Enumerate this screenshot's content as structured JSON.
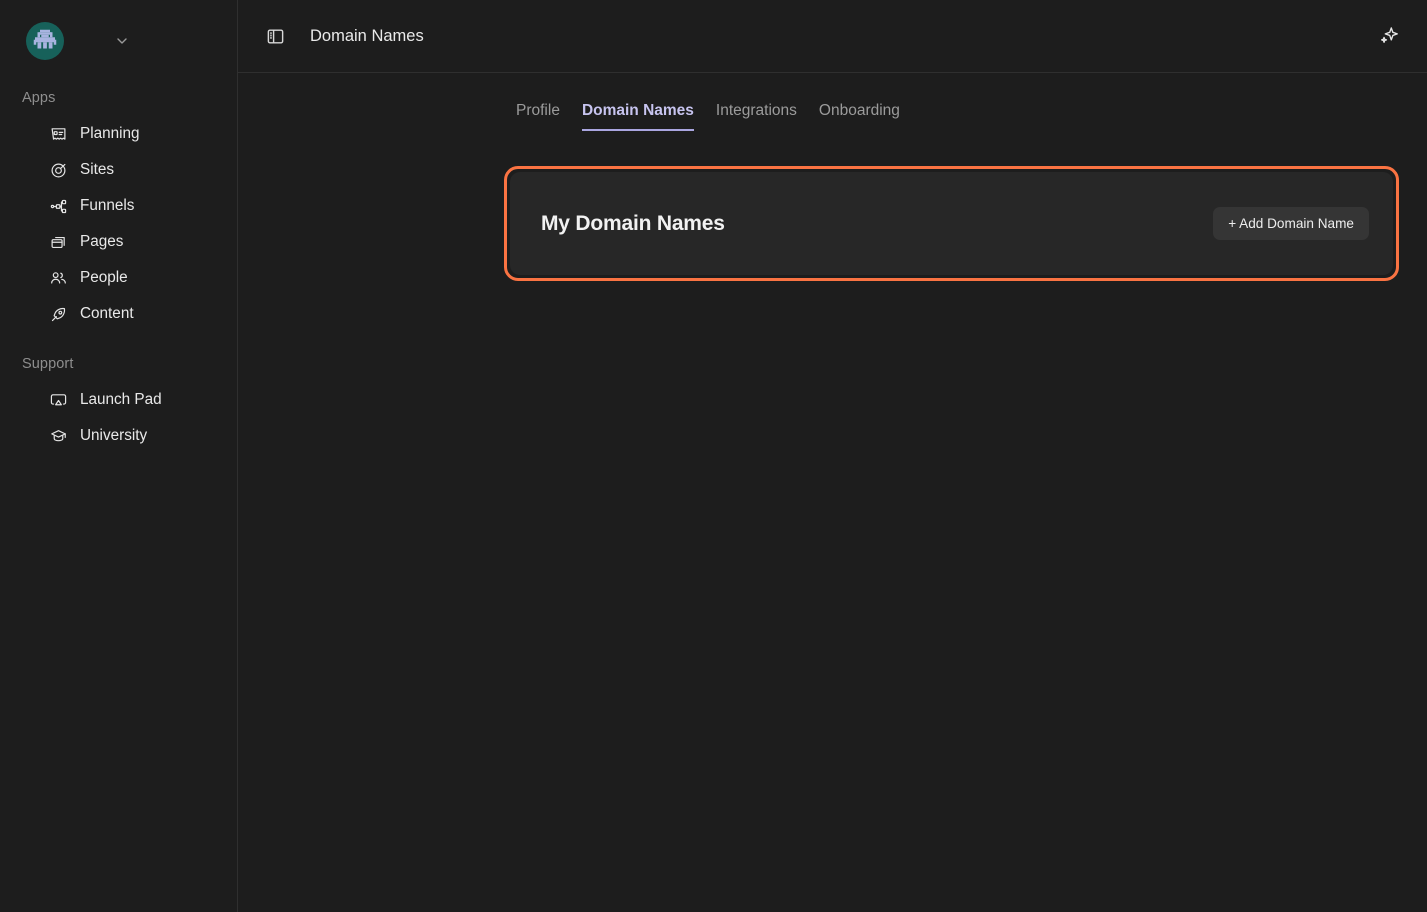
{
  "sidebar": {
    "brand": {
      "logo_icon": "space-invader-avatar",
      "logo_bg_color": "#17615a",
      "logo_fg_color": "#a8b4e0",
      "chevron_icon": "chevron-down-icon"
    },
    "sections": [
      {
        "label": "Apps",
        "items": [
          {
            "label": "Planning",
            "icon": "receipt-id-icon"
          },
          {
            "label": "Sites",
            "icon": "globe-target-icon"
          },
          {
            "label": "Funnels",
            "icon": "workflow-branch-icon"
          },
          {
            "label": "Pages",
            "icon": "stacked-windows-icon"
          },
          {
            "label": "People",
            "icon": "users-icon"
          },
          {
            "label": "Content",
            "icon": "pen-nib-icon"
          }
        ]
      },
      {
        "label": "Support",
        "items": [
          {
            "label": "Launch Pad",
            "icon": "airplay-icon"
          },
          {
            "label": "University",
            "icon": "graduation-cap-icon"
          }
        ]
      }
    ]
  },
  "topbar": {
    "panel_toggle_icon": "sidebar-panel-icon",
    "title": "Domain Names",
    "sparkle_icon": "sparkles-ai-icon"
  },
  "tabs": [
    {
      "label": "Profile",
      "active": false
    },
    {
      "label": "Domain Names",
      "active": true
    },
    {
      "label": "Integrations",
      "active": false
    },
    {
      "label": "Onboarding",
      "active": false
    }
  ],
  "card": {
    "title": "My Domain Names",
    "add_button_label": "+ Add Domain Name",
    "highlight_color": "#fa7342",
    "background_color": "#272727"
  },
  "theme": {
    "page_background": "#1d1d1d",
    "divider": "#2f2f2f",
    "active_tab_color": "#c7c4ef",
    "muted_text": "#9b9b9b"
  }
}
